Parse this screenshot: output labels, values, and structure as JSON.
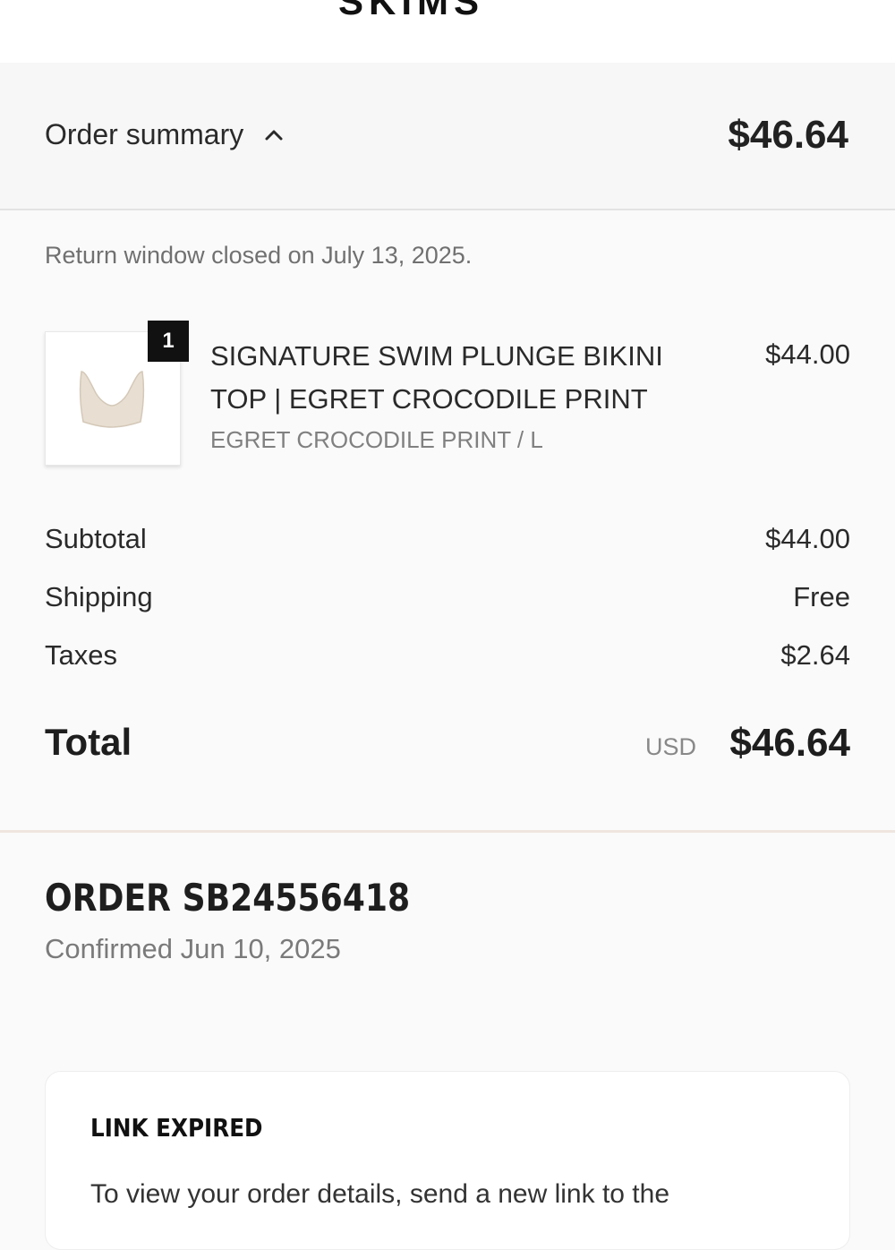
{
  "header": {
    "logo_fragment": "SKIMS"
  },
  "summary_bar": {
    "label": "Order summary",
    "toggle_icon": "chevron-up-icon",
    "total": "$46.64"
  },
  "return_note": "Return window closed on July 13, 2025.",
  "line_items": [
    {
      "quantity": "1",
      "name": "SIGNATURE SWIM PLUNGE BIKINI TOP | EGRET CROCODILE PRINT",
      "variant": "EGRET CROCODILE PRINT / L",
      "price": "$44.00",
      "image_icon": "bikini-top-thumbnail"
    }
  ],
  "costs": {
    "subtotal_label": "Subtotal",
    "subtotal_value": "$44.00",
    "shipping_label": "Shipping",
    "shipping_value": "Free",
    "taxes_label": "Taxes",
    "taxes_value": "$2.64"
  },
  "total": {
    "label": "Total",
    "currency": "USD",
    "value": "$46.64"
  },
  "order": {
    "number": "ORDER SB24556418",
    "confirmed": "Confirmed Jun 10, 2025"
  },
  "expired_card": {
    "title": "LINK EXPIRED",
    "body": "To view your order details, send a new link to the"
  }
}
